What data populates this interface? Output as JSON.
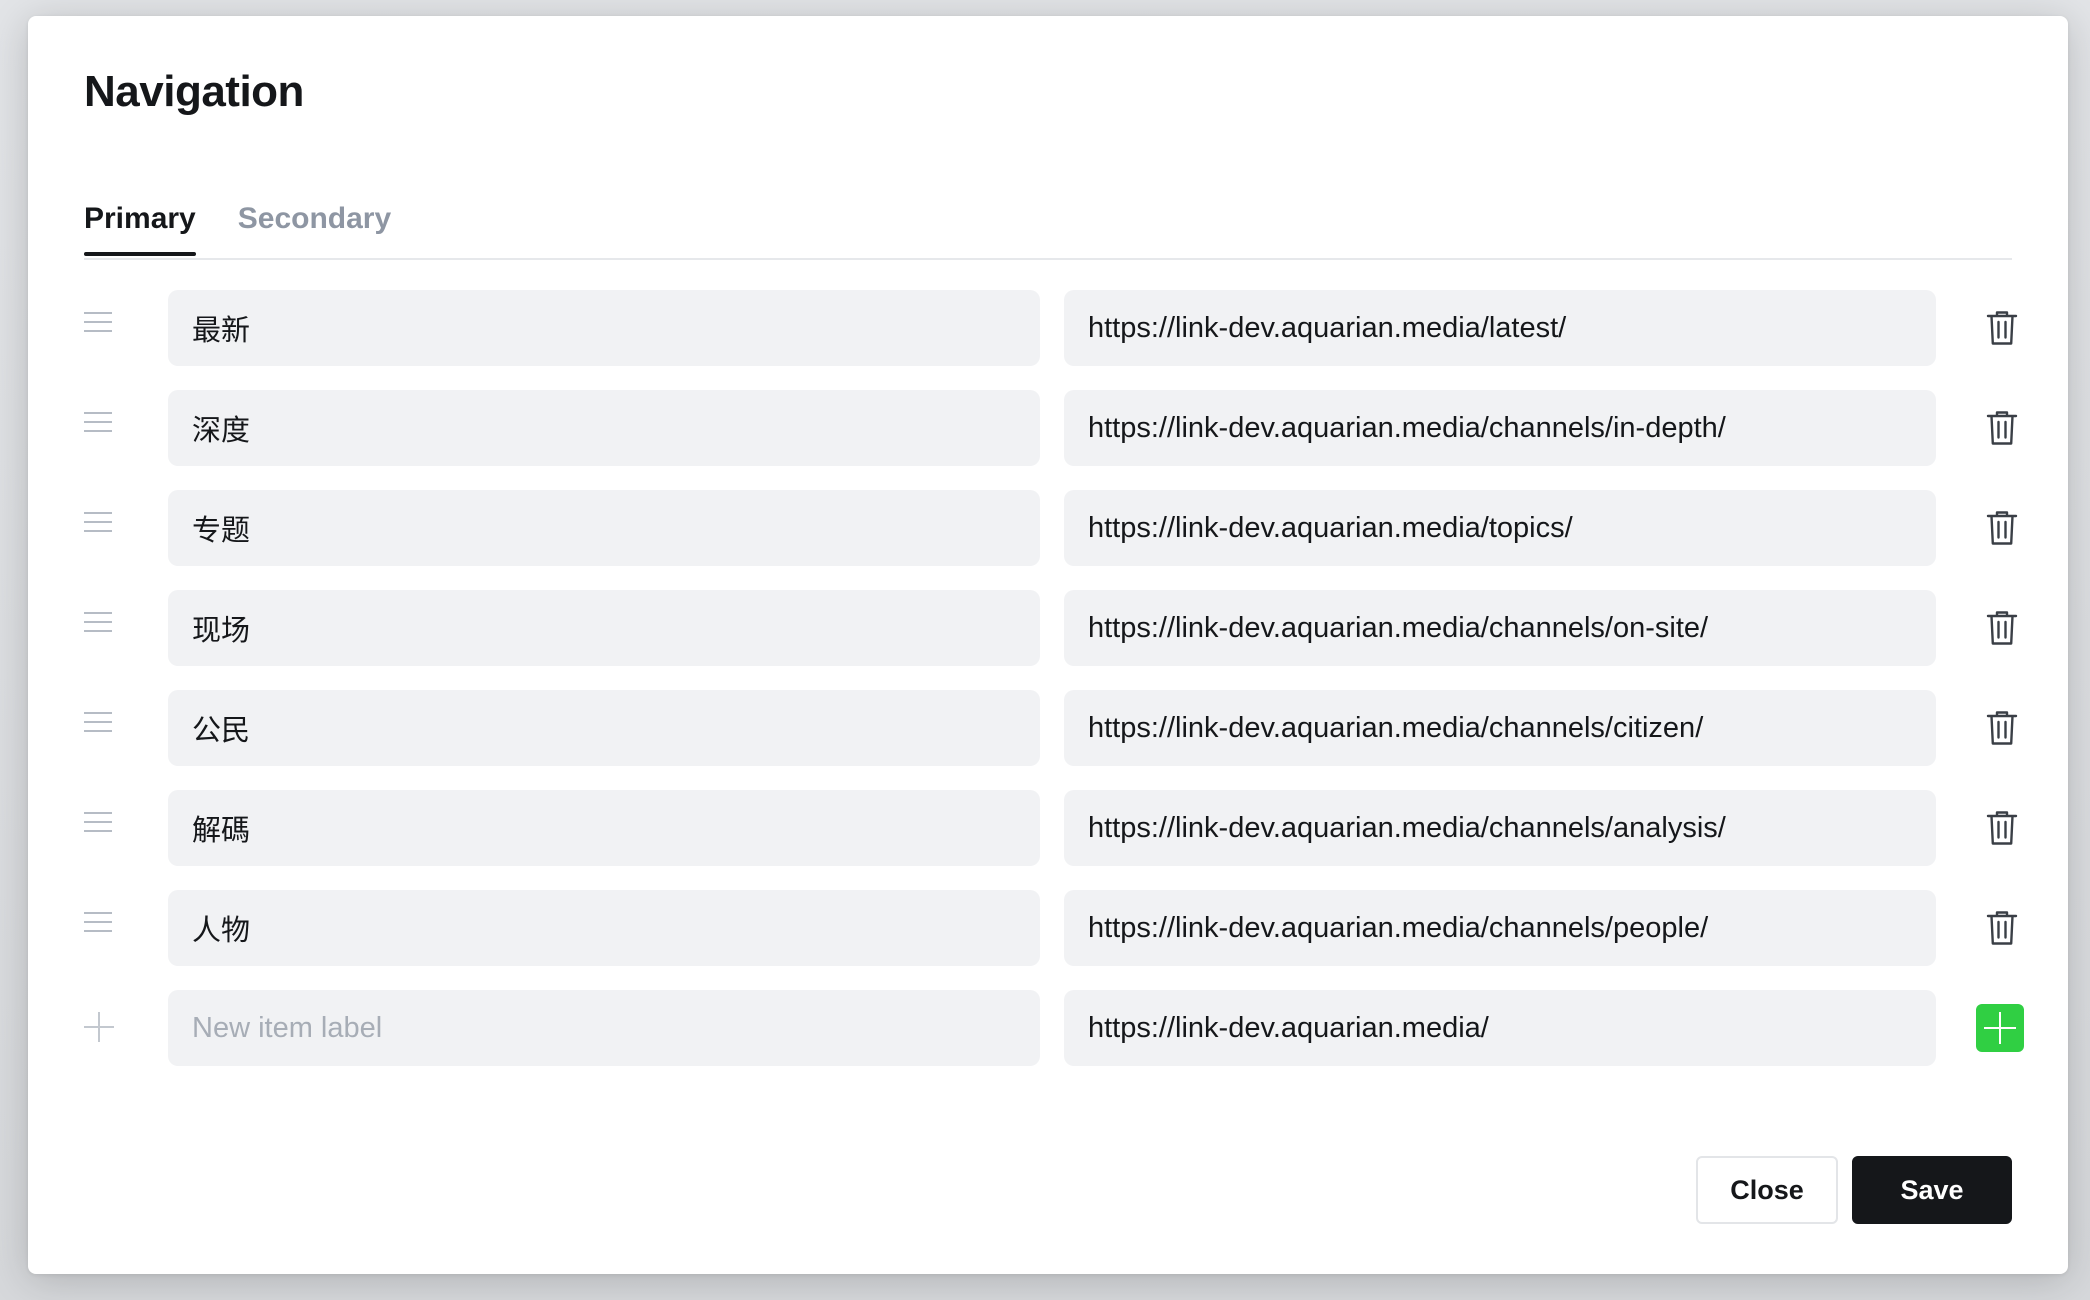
{
  "modal": {
    "title": "Navigation",
    "tabs": [
      {
        "label": "Primary",
        "active": true
      },
      {
        "label": "Secondary",
        "active": false
      }
    ],
    "items": [
      {
        "label": "最新",
        "url": "https://link-dev.aquarian.media/latest/"
      },
      {
        "label": "深度",
        "url": "https://link-dev.aquarian.media/channels/in-depth/"
      },
      {
        "label": "专题",
        "url": "https://link-dev.aquarian.media/topics/"
      },
      {
        "label": "现场",
        "url": "https://link-dev.aquarian.media/channels/on-site/"
      },
      {
        "label": "公民",
        "url": "https://link-dev.aquarian.media/channels/citizen/"
      },
      {
        "label": "解碼",
        "url": "https://link-dev.aquarian.media/channels/analysis/"
      },
      {
        "label": "人物",
        "url": "https://link-dev.aquarian.media/channels/people/"
      }
    ],
    "new_item": {
      "label_placeholder": "New item label",
      "url_value": "https://link-dev.aquarian.media/"
    },
    "buttons": {
      "close_label": "Close",
      "save_label": "Save"
    }
  },
  "icons": {
    "drag": "drag-handle-icon",
    "delete": "trash-icon",
    "add": "plus-icon"
  },
  "colors": {
    "accent_add": "#30cf43",
    "primary_dark": "#15171a",
    "field_bg": "#f1f2f4",
    "tab_inactive": "#8e96a3"
  }
}
